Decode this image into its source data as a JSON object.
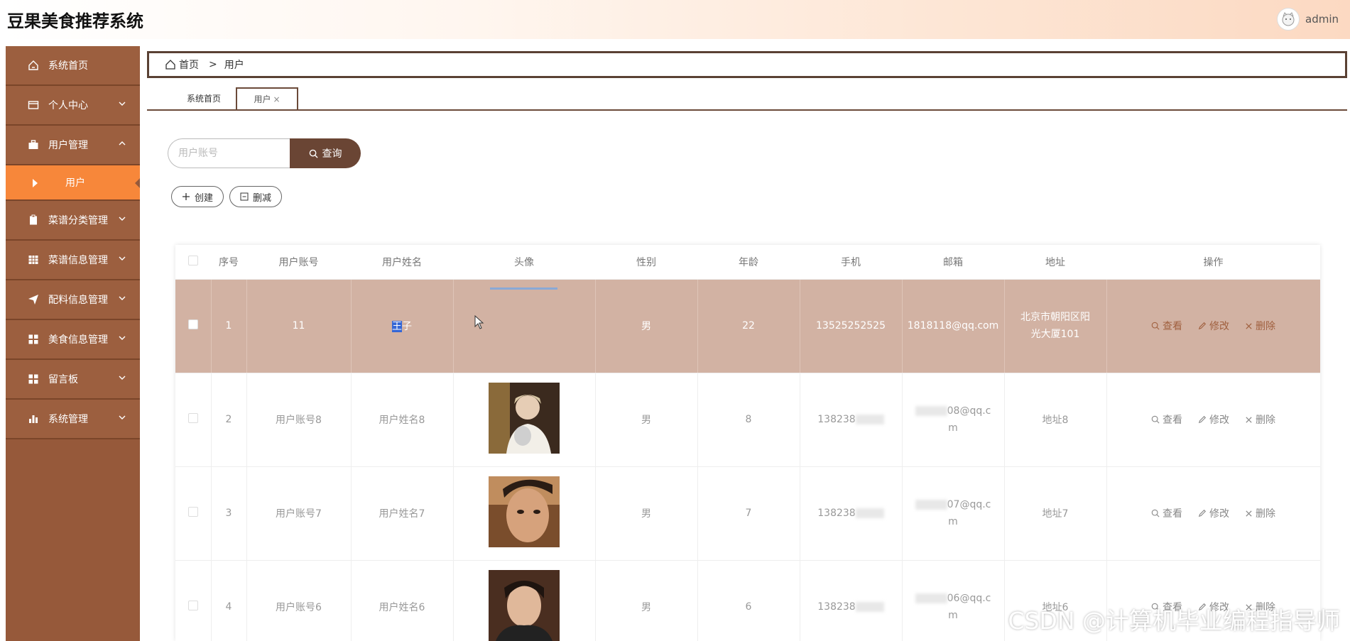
{
  "header": {
    "title": "豆果美食推荐系统",
    "username": "admin"
  },
  "sidebar": {
    "items": [
      {
        "label": "系统首页",
        "icon": "home-icon"
      },
      {
        "label": "个人中心",
        "icon": "card-icon"
      },
      {
        "label": "用户管理",
        "icon": "briefcase-icon"
      },
      {
        "label": "用户",
        "icon": "triangle-right-icon"
      },
      {
        "label": "菜谱分类管理",
        "icon": "clipboard-icon"
      },
      {
        "label": "菜谱信息管理",
        "icon": "grid-icon"
      },
      {
        "label": "配料信息管理",
        "icon": "send-icon"
      },
      {
        "label": "美食信息管理",
        "icon": "grid-four-icon"
      },
      {
        "label": "留言板",
        "icon": "grid-four-icon"
      },
      {
        "label": "系统管理",
        "icon": "bar-chart-icon"
      }
    ]
  },
  "breadcrumb": {
    "home": "首页",
    "sep": ">",
    "current": "用户"
  },
  "tabs": {
    "home": "系统首页",
    "user": "用户",
    "close": "×"
  },
  "search": {
    "placeholder": "用户账号",
    "button": "查询"
  },
  "actions": {
    "create": "创建",
    "delete": "删减"
  },
  "table": {
    "headers": [
      "序号",
      "用户账号",
      "用户姓名",
      "头像",
      "性别",
      "年龄",
      "手机",
      "邮箱",
      "地址",
      "操作"
    ],
    "ops": {
      "view": "查看",
      "edit": "修改",
      "delete": "删除"
    },
    "rows": [
      {
        "index": "1",
        "account": "11",
        "name_hl": "王",
        "name_rest": "子",
        "gender": "男",
        "age": "22",
        "phone": "13525252525",
        "email": "1818118@qq.com",
        "address": "北京市朝阳区阳光大厦101"
      },
      {
        "index": "2",
        "account": "用户账号8",
        "name": "用户姓名8",
        "gender": "男",
        "age": "8",
        "phone": "138238",
        "email_a": "08@qq.c",
        "email_b": "m",
        "address": "地址8"
      },
      {
        "index": "3",
        "account": "用户账号7",
        "name": "用户姓名7",
        "gender": "男",
        "age": "7",
        "phone": "138238",
        "email_a": "07@qq.c",
        "email_b": "m",
        "address": "地址7"
      },
      {
        "index": "4",
        "account": "用户账号6",
        "name": "用户姓名6",
        "gender": "男",
        "age": "6",
        "phone": "138238",
        "email_a": "06@qq.c",
        "email_b": "m",
        "address": "地址6"
      }
    ]
  },
  "watermark": "CSDN @计算机毕业编程指导师"
}
